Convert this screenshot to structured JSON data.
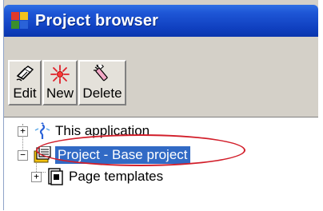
{
  "window": {
    "title": "Project browser"
  },
  "toolbar": {
    "buttons": [
      {
        "label": "Edit",
        "icon": "edit-icon"
      },
      {
        "label": "New",
        "icon": "new-icon"
      },
      {
        "label": "Delete",
        "icon": "delete-icon"
      }
    ]
  },
  "tree": {
    "nodes": [
      {
        "label": "This application",
        "expander": "+",
        "icon": "application-icon"
      },
      {
        "label": "Project - Base project",
        "expander": "−",
        "icon": "project-icon",
        "selected": true
      },
      {
        "label": "Page templates",
        "expander": "+",
        "icon": "page-templates-icon"
      }
    ]
  },
  "colors": {
    "titlebar": "#0f3fbf",
    "selection": "#316ac5",
    "annotation": "#d21e2a"
  }
}
